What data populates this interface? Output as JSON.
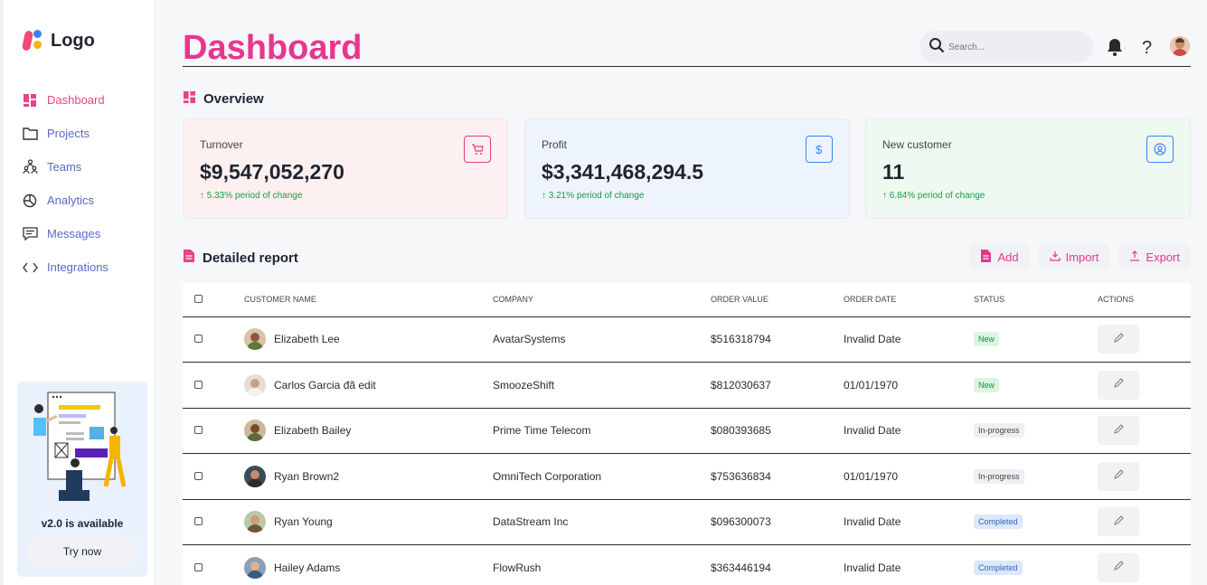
{
  "app": {
    "logo_text": "Logo"
  },
  "sidebar": {
    "items": [
      {
        "label": "Dashboard",
        "icon": "dashboard-grid-icon",
        "active": true
      },
      {
        "label": "Projects",
        "icon": "folder-icon",
        "active": false
      },
      {
        "label": "Teams",
        "icon": "teams-icon",
        "active": false
      },
      {
        "label": "Analytics",
        "icon": "pie-chart-icon",
        "active": false
      },
      {
        "label": "Messages",
        "icon": "message-icon",
        "active": false
      },
      {
        "label": "Integrations",
        "icon": "code-icon",
        "active": false
      }
    ],
    "promo": {
      "title": "v2.0 is available",
      "button": "Try now"
    }
  },
  "header": {
    "title": "Dashboard",
    "search_placeholder": "Search..."
  },
  "overview": {
    "heading": "Overview",
    "cards": [
      {
        "label": "Turnover",
        "value": "$9,547,052,270",
        "change": "↑ 5.33% period of change",
        "icon": "cart-icon",
        "bg": "#fdf0f0",
        "accent": "#e8368f"
      },
      {
        "label": "Profit",
        "value": "$3,341,468,294.5",
        "change": "↑ 3.21% period of change",
        "icon": "dollar-icon",
        "bg": "#eef4fd",
        "accent": "#3b82f6"
      },
      {
        "label": "New customer",
        "value": "11",
        "change": "↑ 6.84% period of change",
        "icon": "user-circle-icon",
        "bg": "#eefaf1",
        "accent": "#3b82f6"
      }
    ]
  },
  "report": {
    "heading": "Detailed report",
    "actions": {
      "add": "Add",
      "import": "Import",
      "export": "Export"
    },
    "columns": [
      "CUSTOMER NAME",
      "COMPANY",
      "ORDER VALUE",
      "ORDER DATE",
      "STATUS",
      "ACTIONS"
    ],
    "rows": [
      {
        "name": "Elizabeth Lee",
        "company": "AvatarSystems",
        "value": "$516318794",
        "date": "Invalid Date",
        "status": "New"
      },
      {
        "name": "Carlos Garcia đã edit",
        "company": "SmoozeShift",
        "value": "$812030637",
        "date": "01/01/1970",
        "status": "New"
      },
      {
        "name": "Elizabeth Bailey",
        "company": "Prime Time Telecom",
        "value": "$080393685",
        "date": "Invalid Date",
        "status": "In-progress"
      },
      {
        "name": "Ryan Brown2",
        "company": "OmniTech Corporation",
        "value": "$753636834",
        "date": "01/01/1970",
        "status": "In-progress"
      },
      {
        "name": "Ryan Young",
        "company": "DataStream Inc",
        "value": "$096300073",
        "date": "Invalid Date",
        "status": "Completed"
      },
      {
        "name": "Hailey Adams",
        "company": "FlowRush",
        "value": "$363446194",
        "date": "Invalid Date",
        "status": "Completed"
      }
    ]
  },
  "colors": {
    "accent": "#e8368f",
    "nav": "#5b67c9"
  }
}
